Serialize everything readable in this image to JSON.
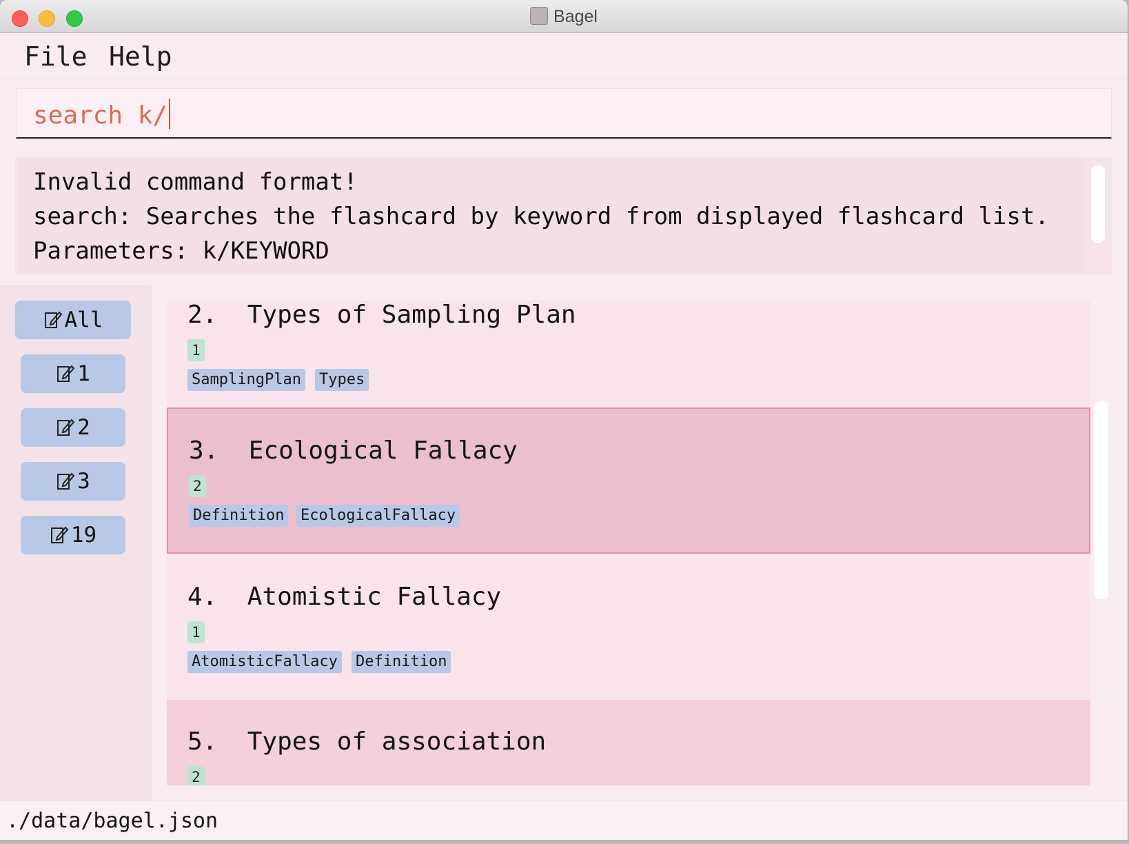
{
  "window": {
    "title": "Bagel"
  },
  "menu": {
    "file": "File",
    "help": "Help"
  },
  "command": {
    "value": "search k/"
  },
  "result": {
    "lines": [
      "Invalid command format!",
      "search: Searches the flashcard by keyword from displayed flashcard list.",
      "Parameters: k/KEYWORD"
    ]
  },
  "decks": [
    {
      "label": "All",
      "icon": "edit-icon"
    },
    {
      "label": "1",
      "icon": "edit-icon"
    },
    {
      "label": "2",
      "icon": "edit-icon"
    },
    {
      "label": "3",
      "icon": "edit-icon"
    },
    {
      "label": "19",
      "icon": "edit-icon"
    }
  ],
  "flashcards": [
    {
      "index": "2.",
      "title": "Types of Sampling Plan",
      "set": "1",
      "tags": [
        "SamplingPlan",
        "Types"
      ]
    },
    {
      "index": "3.",
      "title": "Ecological Fallacy",
      "set": "2",
      "tags": [
        "Definition",
        "EcologicalFallacy"
      ],
      "selected": true
    },
    {
      "index": "4.",
      "title": "Atomistic Fallacy",
      "set": "1",
      "tags": [
        "AtomisticFallacy",
        "Definition"
      ]
    },
    {
      "index": "5.",
      "title": "Types of association",
      "set": "2",
      "tags": []
    }
  ],
  "status": {
    "path": "./data/bagel.json"
  },
  "colors": {
    "card_even": "#f7dfe7",
    "card_odd": "#f8e4ea",
    "card_selected": "#ebbfcd",
    "card_selected_border": "#e48bab",
    "tag": "#b8c8e6",
    "set_badge": "#bfe3d3",
    "command_text": "#d66d5a"
  }
}
